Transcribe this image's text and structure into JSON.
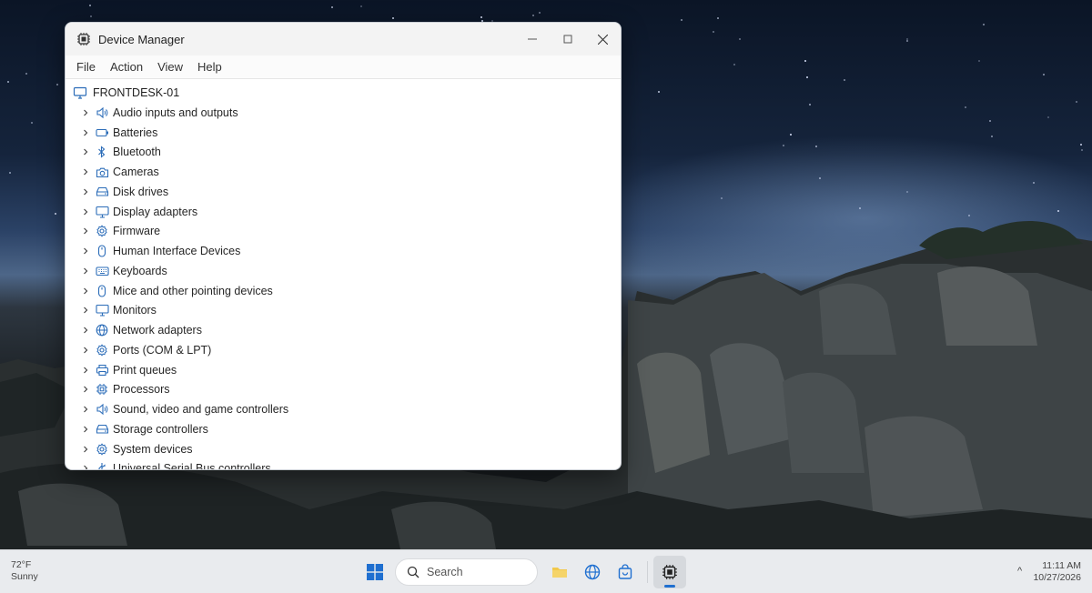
{
  "window": {
    "title": "Device Manager",
    "menu": [
      "File",
      "Action",
      "View",
      "Help"
    ]
  },
  "tree": {
    "root": "FRONTDESK-01",
    "items": [
      {
        "label": "Audio inputs and outputs",
        "icon": "speaker-icon"
      },
      {
        "label": "Batteries",
        "icon": "battery-icon"
      },
      {
        "label": "Bluetooth",
        "icon": "bluetooth-icon"
      },
      {
        "label": "Cameras",
        "icon": "camera-icon"
      },
      {
        "label": "Disk drives",
        "icon": "disk-drive-icon"
      },
      {
        "label": "Display adapters",
        "icon": "display-icon"
      },
      {
        "label": "Firmware",
        "icon": "gear-icon"
      },
      {
        "label": "Human Interface Devices",
        "icon": "mouse-icon"
      },
      {
        "label": "Keyboards",
        "icon": "keyboard-icon"
      },
      {
        "label": "Mice and other pointing devices",
        "icon": "mouse-icon"
      },
      {
        "label": "Monitors",
        "icon": "display-icon"
      },
      {
        "label": "Network adapters",
        "icon": "globe-icon"
      },
      {
        "label": "Ports (COM & LPT)",
        "icon": "gear-icon"
      },
      {
        "label": "Print queues",
        "icon": "printer-icon"
      },
      {
        "label": "Processors",
        "icon": "chip-icon"
      },
      {
        "label": "Sound, video and game controllers",
        "icon": "speaker-icon"
      },
      {
        "label": "Storage controllers",
        "icon": "disk-drive-icon"
      },
      {
        "label": "System devices",
        "icon": "gear-icon"
      },
      {
        "label": "Universal Serial Bus controllers",
        "icon": "usb-icon"
      }
    ]
  },
  "taskbar": {
    "weather_temp": "72°F",
    "weather_desc": "Sunny",
    "search_placeholder": "Search",
    "time": "11:11 AM",
    "date": "10/27/2026"
  },
  "colors": {
    "accent": "#1f6fd0",
    "icon_blue": "#2b6cb8"
  }
}
